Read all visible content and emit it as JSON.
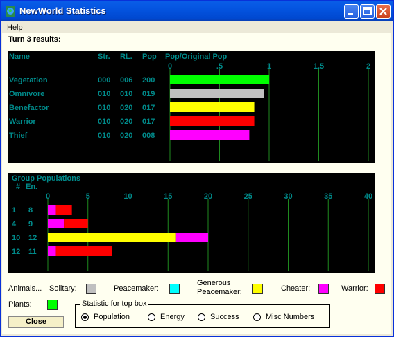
{
  "window": {
    "title": "NewWorld Statistics",
    "menu": [
      "Help"
    ],
    "turn_text": "Turn 3 results:"
  },
  "top_box": {
    "headers": {
      "name": "Name",
      "str": "Str.",
      "rl": "RL.",
      "pop": "Pop",
      "ratio": "Pop/Original Pop"
    },
    "axis_ticks": [
      "0",
      ".5",
      "1",
      "1.5",
      "2"
    ],
    "rows": [
      {
        "name": "Vegetation",
        "str": "000",
        "rl": "006",
        "pop": "200",
        "ratio": 1.0,
        "color": "#00ff00"
      },
      {
        "name": "Omnivore",
        "str": "010",
        "rl": "010",
        "pop": "019",
        "ratio": 0.95,
        "color": "#c0c0c0"
      },
      {
        "name": "Benefactor",
        "str": "010",
        "rl": "020",
        "pop": "017",
        "ratio": 0.85,
        "color": "#ffff00"
      },
      {
        "name": "Warrior",
        "str": "010",
        "rl": "020",
        "pop": "017",
        "ratio": 0.85,
        "color": "#ff0000"
      },
      {
        "name": "Thief",
        "str": "010",
        "rl": "020",
        "pop": "008",
        "ratio": 0.8,
        "color": "#ff00ff"
      }
    ]
  },
  "group_box": {
    "title": "Group Populations",
    "headers": {
      "num": "#",
      "en": "En."
    },
    "axis_ticks": [
      "0",
      "5",
      "10",
      "15",
      "20",
      "25",
      "30",
      "35",
      "40"
    ],
    "rows": [
      {
        "num": "1",
        "en": "8",
        "segments": [
          {
            "value": 1,
            "color": "#ff00ff"
          },
          {
            "value": 2,
            "color": "#ff0000"
          }
        ]
      },
      {
        "num": "4",
        "en": "9",
        "segments": [
          {
            "value": 2,
            "color": "#ff00ff"
          },
          {
            "value": 3,
            "color": "#ff0000"
          }
        ]
      },
      {
        "num": "10",
        "en": "12",
        "segments": [
          {
            "value": 16,
            "color": "#ffff00"
          },
          {
            "value": 4,
            "color": "#ff00ff"
          }
        ]
      },
      {
        "num": "12",
        "en": "11",
        "segments": [
          {
            "value": 1,
            "color": "#ff00ff"
          },
          {
            "value": 7,
            "color": "#ff0000"
          }
        ]
      }
    ]
  },
  "legend": {
    "animals": "Animals...",
    "solitary": "Solitary:",
    "peacemaker": "Peacemaker:",
    "generous_1": "Generous",
    "generous_2": "Peacemaker:",
    "cheater": "Cheater:",
    "warrior": "Warrior:",
    "plants": "Plants:",
    "colors": {
      "solitary": "#c0c0c0",
      "peacemaker": "#00ffff",
      "generous": "#ffff00",
      "cheater": "#ff00ff",
      "warrior": "#ff0000",
      "plants": "#00ff00"
    }
  },
  "close_label": "Close",
  "stat_box": {
    "legend": "Statistic for top box",
    "options": [
      "Population",
      "Energy",
      "Success",
      "Misc Numbers"
    ],
    "selected": "Population"
  },
  "chart_data": [
    {
      "type": "bar",
      "categories": [
        "Vegetation",
        "Omnivore",
        "Benefactor",
        "Warrior",
        "Thief"
      ],
      "values": [
        1.0,
        0.95,
        0.85,
        0.85,
        0.8
      ],
      "title": "",
      "xlabel": "Pop/Original Pop",
      "ylabel": "",
      "xlim": [
        0,
        2
      ]
    },
    {
      "type": "bar",
      "title": "Group Populations",
      "categories": [
        "1",
        "4",
        "10",
        "12"
      ],
      "series": [
        {
          "values": [
            1,
            2,
            0,
            1
          ]
        },
        {
          "values": [
            2,
            3,
            0,
            7
          ]
        },
        {
          "values": [
            0,
            0,
            16,
            0
          ]
        },
        {
          "values": [
            0,
            0,
            4,
            0
          ]
        }
      ],
      "xlim": [
        0,
        40
      ]
    }
  ]
}
